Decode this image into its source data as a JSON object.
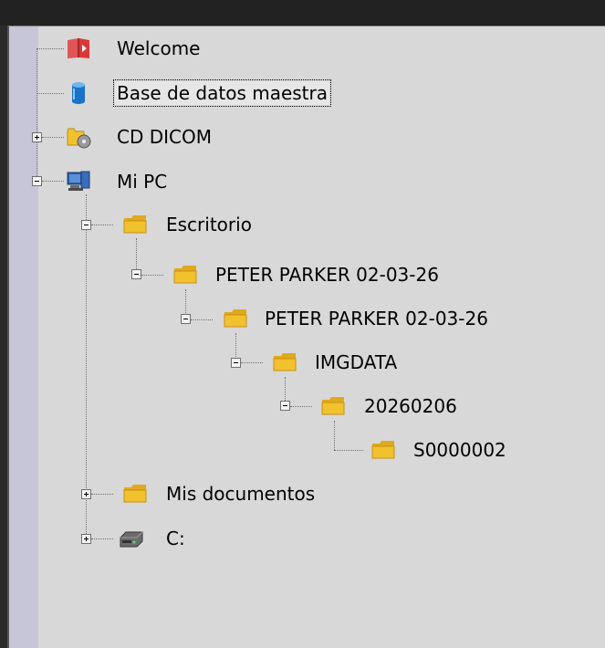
{
  "tree": {
    "welcome": {
      "label": "Welcome",
      "icon": "welcome-book-icon"
    },
    "master_db": {
      "label": "Base de datos maestra",
      "icon": "database-icon",
      "selected": true
    },
    "cd_dicom": {
      "label": "CD DICOM",
      "icon": "cd-folder-icon",
      "expanded": false
    },
    "mi_pc": {
      "label": "Mi PC",
      "icon": "computer-icon",
      "expanded": true,
      "children": {
        "escritorio": {
          "label": "Escritorio",
          "icon": "folder-icon",
          "expanded": true,
          "children": {
            "peter1": {
              "label": "PETER PARKER 02-03-26",
              "icon": "folder-icon",
              "expanded": true,
              "children": {
                "peter2": {
                  "label": "PETER PARKER 02-03-26",
                  "icon": "folder-icon",
                  "expanded": true,
                  "children": {
                    "imgdata": {
                      "label": "IMGDATA",
                      "icon": "folder-icon",
                      "expanded": true,
                      "children": {
                        "date": {
                          "label": "20260206",
                          "icon": "folder-icon",
                          "expanded": true,
                          "children": {
                            "series": {
                              "label": "S0000002",
                              "icon": "folder-icon"
                            }
                          }
                        }
                      }
                    }
                  }
                }
              }
            }
          }
        },
        "mis_documentos": {
          "label": "Mis documentos",
          "icon": "folder-icon",
          "expanded": false
        },
        "c_drive": {
          "label": "C:",
          "icon": "drive-icon",
          "expanded": false
        }
      }
    }
  },
  "colors": {
    "panel_bg": "#d8d8d8",
    "gutter_bg": "#c7c6d8",
    "folder_yellow": "#f2c12e",
    "welcome_red": "#d9383a",
    "database_blue": "#1a73c9"
  }
}
